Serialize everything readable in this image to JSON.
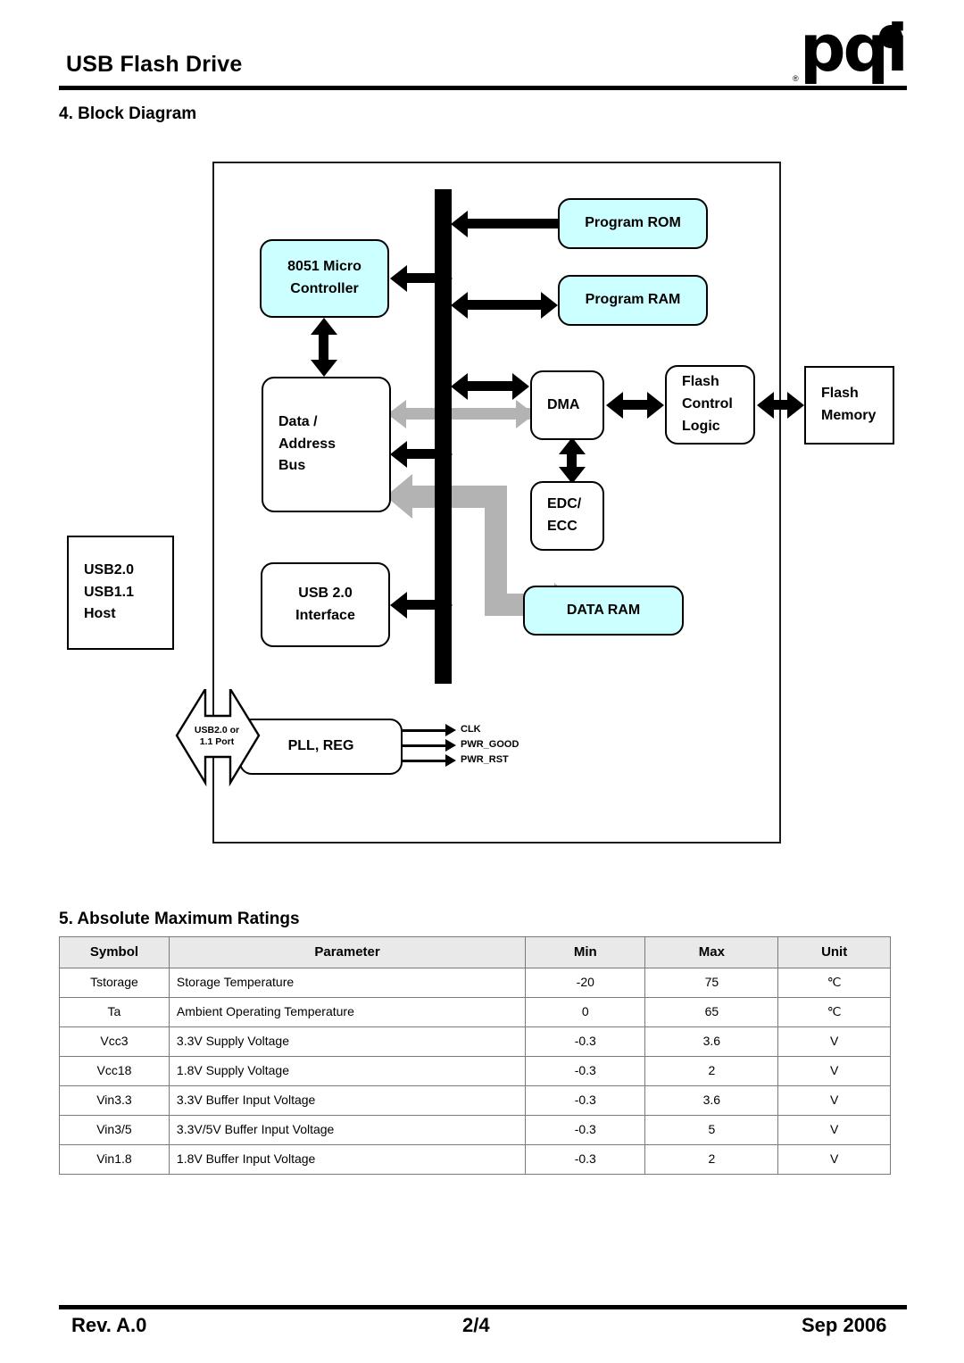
{
  "header": {
    "title": "USB Flash Drive",
    "logo_text": "pqi",
    "logo_reg": "®"
  },
  "sections": {
    "block_diagram_title": "4. Block Diagram",
    "ratings_title": "5. Absolute Maximum Ratings"
  },
  "diagram": {
    "blocks": {
      "mcu": "8051 Micro\nController",
      "mcu_line1": "8051 Micro",
      "mcu_line2": "Controller",
      "program_rom": "Program ROM",
      "program_ram": "Program RAM",
      "data_bus_line1": "Data /",
      "data_bus_line2": "Address",
      "data_bus_line3": "Bus",
      "dma": "DMA",
      "edc_line1": "EDC/",
      "edc_line2": "ECC",
      "flash_control_line1": "Flash",
      "flash_control_line2": "Control",
      "flash_control_line3": "Logic",
      "flash_memory_line1": "Flash",
      "flash_memory_line2": "Memory",
      "usb_host_line1": "USB2.0",
      "usb_host_line2": "USB1.1",
      "usb_host_line3": "Host",
      "usb_if_line1": "USB 2.0",
      "usb_if_line2": "Interface",
      "data_ram": "DATA RAM",
      "pll_reg": "PLL, REG"
    },
    "labels": {
      "usb_port_line1": "USB2.0 or",
      "usb_port_line2": "1.1 Port",
      "clk": "CLK",
      "pwr_good": "PWR_GOOD",
      "pwr_rst": "PWR_RST"
    },
    "colors": {
      "memory_block_fill": "#ccffff",
      "bus_black": "#000000",
      "data_path_gray": "#b3b3b3"
    }
  },
  "ratings": {
    "columns": [
      "Symbol",
      "Parameter",
      "Min",
      "Max",
      "Unit"
    ],
    "rows": [
      {
        "symbol": "Tstorage",
        "parameter": "Storage Temperature",
        "min": "-20",
        "max": "75",
        "unit": "℃"
      },
      {
        "symbol": "Ta",
        "parameter": "Ambient Operating Temperature",
        "min": "0",
        "max": "65",
        "unit": "℃"
      },
      {
        "symbol": "Vcc3",
        "parameter": "3.3V Supply Voltage",
        "min": "-0.3",
        "max": "3.6",
        "unit": "V"
      },
      {
        "symbol": "Vcc18",
        "parameter": "1.8V Supply Voltage",
        "min": "-0.3",
        "max": "2",
        "unit": "V"
      },
      {
        "symbol": "Vin3.3",
        "parameter": "3.3V Buffer Input Voltage",
        "min": "-0.3",
        "max": "3.6",
        "unit": "V"
      },
      {
        "symbol": "Vin3/5",
        "parameter": "3.3V/5V Buffer Input Voltage",
        "min": "-0.3",
        "max": "5",
        "unit": "V"
      },
      {
        "symbol": "Vin1.8",
        "parameter": "1.8V Buffer Input Voltage",
        "min": "-0.3",
        "max": "2",
        "unit": "V"
      }
    ]
  },
  "footer": {
    "revision": "Rev. A.0",
    "page": "2/4",
    "date": "Sep 2006"
  }
}
